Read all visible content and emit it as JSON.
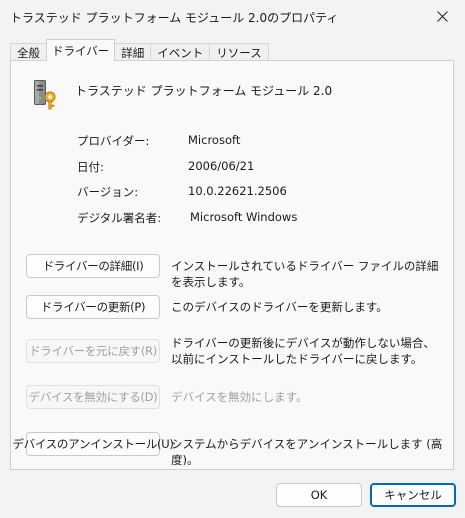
{
  "window": {
    "title": "トラステッド プラットフォーム モジュール 2.0のプロパティ"
  },
  "tabs": [
    {
      "label": "全般"
    },
    {
      "label": "ドライバー",
      "active": true
    },
    {
      "label": "詳細"
    },
    {
      "label": "イベント"
    },
    {
      "label": "リソース"
    }
  ],
  "device": {
    "name": "トラステッド プラットフォーム モジュール 2.0",
    "icon": "tpm-chip-key-icon"
  },
  "properties": [
    {
      "label": "プロバイダー:",
      "value": "Microsoft"
    },
    {
      "label": "日付:",
      "value": "2006/06/21"
    },
    {
      "label": "バージョン:",
      "value": "10.0.22621.2506"
    },
    {
      "label": "デジタル署名者:",
      "value": "Microsoft Windows"
    }
  ],
  "actions": [
    {
      "label": "ドライバーの詳細(I)",
      "description": "インストールされているドライバー ファイルの詳細を表示します。",
      "enabled": true
    },
    {
      "label": "ドライバーの更新(P)",
      "description": "このデバイスのドライバーを更新します。",
      "enabled": true
    },
    {
      "label": "ドライバーを元に戻す(R)",
      "description": "ドライバーの更新後にデバイスが動作しない場合、以前にインストールしたドライバーに戻します。",
      "enabled": false
    },
    {
      "label": "デバイスを無効にする(D)",
      "description": "デバイスを無効にします。",
      "enabled": false
    },
    {
      "label": "デバイスのアンインストール(U)",
      "description": "システムからデバイスをアンインストールします (高度)。",
      "enabled": true
    }
  ],
  "footer": {
    "ok_label": "OK",
    "cancel_label": "キャンセル"
  },
  "colors": {
    "accent": "#0067c0",
    "disabled_text": "#a0a0a0"
  }
}
